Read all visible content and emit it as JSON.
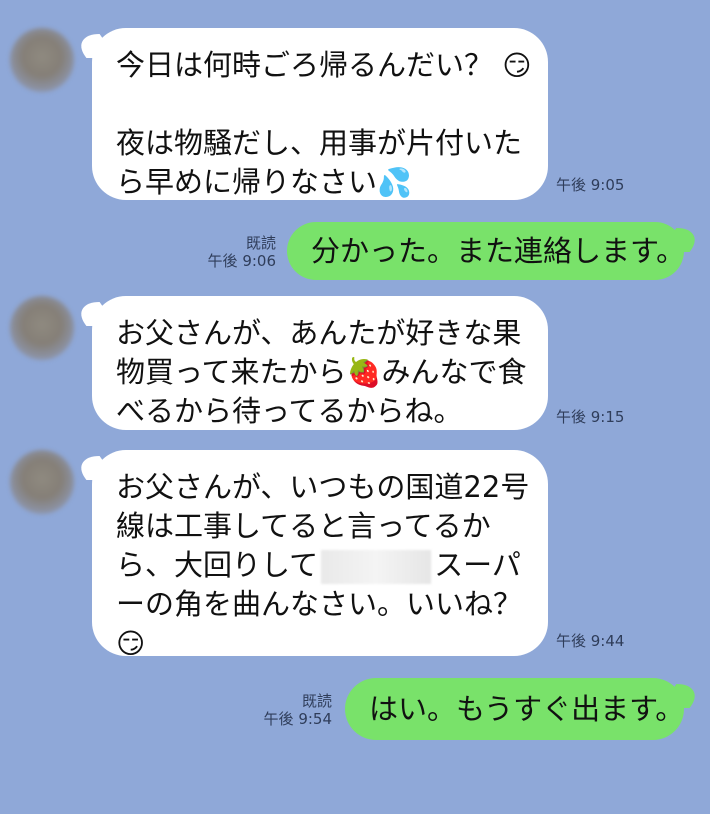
{
  "messages": [
    {
      "lines": [
        "今日は何時ごろ帰るんだい？",
        "",
        "夜は物騒だし、用事が片付いた",
        "ら早めに帰りなさい"
      ],
      "emojis": [
        "😏",
        "💦"
      ],
      "time": "午後 9:05"
    },
    {
      "lines": [
        "分かった。また連絡します。"
      ],
      "read": "既読",
      "time": "午後 9:06"
    },
    {
      "lines": [
        "お父さんが、あんたが好きな果",
        "物買って来たから",
        "みんなで食",
        "べるから待ってるからね。"
      ],
      "emojis": [
        "🍓"
      ],
      "time": "午後 9:15"
    },
    {
      "lines": [
        "お父さんが、いつもの国道22号",
        "線は工事してると言ってるか",
        "ら、大回りして",
        "スーパ",
        "ーの角を曲んなさい。いいね？"
      ],
      "emojis": [
        "😏"
      ],
      "time": "午後 9:44"
    },
    {
      "lines": [
        "はい。もうすぐ出ます。"
      ],
      "read": "既読",
      "time": "午後 9:54"
    }
  ]
}
